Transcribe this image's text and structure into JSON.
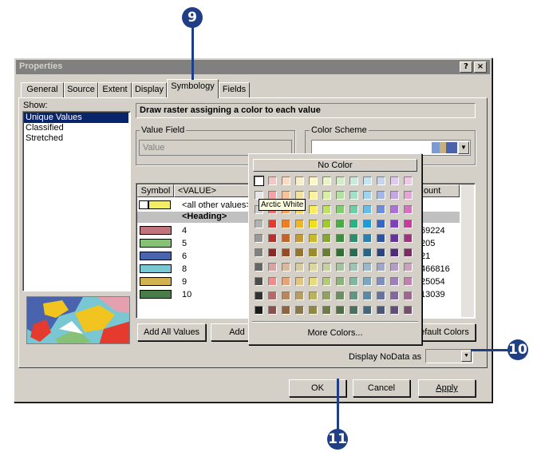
{
  "window": {
    "title": "Properties",
    "help_btn": "?",
    "close_btn": "×"
  },
  "tabs": [
    "General",
    "Source",
    "Extent",
    "Display",
    "Symbology",
    "Fields"
  ],
  "show": {
    "label": "Show:",
    "items": [
      "Unique Values",
      "Classified",
      "Stretched"
    ]
  },
  "header": "Draw raster assigning a color to each value",
  "value_field": {
    "label": "Value Field",
    "value": "Value"
  },
  "color_scheme": {
    "label": "Color Scheme"
  },
  "table": {
    "headers": [
      "Symbol",
      "<VALUE>",
      "Count"
    ],
    "rows": [
      {
        "color": "#f2ee6a",
        "label": "<all other values>",
        "count": ""
      },
      {
        "color": "",
        "label": "<Heading>",
        "count": ""
      },
      {
        "color": "#c2747c",
        "label": "4",
        "count": "69224"
      },
      {
        "color": "#86c176",
        "label": "5",
        "count": "205"
      },
      {
        "color": "#4a63ad",
        "label": "6",
        "count": "21"
      },
      {
        "color": "#78c7d2",
        "label": "8",
        "count": "466816"
      },
      {
        "color": "#d1b24e",
        "label": "9",
        "count": "25054"
      },
      {
        "color": "#4a7c4a",
        "label": "10",
        "count": "13039"
      }
    ]
  },
  "buttons": {
    "add_all": "Add All Values",
    "add_values": "Add Values...",
    "default_colors": "Default Colors",
    "ok": "OK",
    "cancel": "Cancel",
    "apply": "Apply"
  },
  "nodata": {
    "label": "Display NoData as"
  },
  "palette": {
    "no_color": "No Color",
    "more_colors": "More Colors...",
    "tooltip": "Arctic White",
    "rows": [
      [
        "#ffffff",
        "#f4c6c6",
        "#f6dcc4",
        "#f8efc6",
        "#fbf7c8",
        "#e9f4c4",
        "#d2ecca",
        "#c8ecdc",
        "#c6e4f0",
        "#c7d4ef",
        "#dccbed",
        "#f0c8e6"
      ],
      [
        "#e6e6e6",
        "#f3a3a3",
        "#f6c39a",
        "#f7e29c",
        "#fbf29e",
        "#d8ef9e",
        "#b3e0a5",
        "#a2e0c7",
        "#a1d3ec",
        "#a3b7e8",
        "#c4a6e4",
        "#e5a3d8"
      ],
      [
        "#cccccc",
        "#f26b6b",
        "#f5a15f",
        "#f6d35e",
        "#f8ec5f",
        "#c0e35e",
        "#84cc72",
        "#6ad0a6",
        "#67bde6",
        "#6b8edd",
        "#a774d6",
        "#d970c3"
      ],
      [
        "#b2b2b2",
        "#e53a2e",
        "#ef7d22",
        "#f2b61f",
        "#efdf1d",
        "#9fcc2a",
        "#4bab48",
        "#27b382",
        "#1d9bd8",
        "#3366c9",
        "#7f3fbc",
        "#c93a9d"
      ],
      [
        "#999999",
        "#b8302a",
        "#c4642a",
        "#c79a2b",
        "#c9bb2c",
        "#86a833",
        "#3f8c43",
        "#2a8f6c",
        "#2a7fad",
        "#2c54a2",
        "#643596",
        "#a0327f"
      ],
      [
        "#808080",
        "#8c2a25",
        "#954d27",
        "#977428",
        "#9a8d29",
        "#67802e",
        "#336d37",
        "#276d55",
        "#286486",
        "#284482",
        "#502d77",
        "#7c2a65"
      ],
      [
        "#666666",
        "#d9a3a3",
        "#d8b89e",
        "#d8cb9e",
        "#d9d6a0",
        "#c4d09e",
        "#a6c1a1",
        "#9dc4b5",
        "#9cb8c8",
        "#9fa9c7",
        "#b1a0c3",
        "#cc9fbd"
      ],
      [
        "#4d4d4d",
        "#f28c8c",
        "#e5a57a",
        "#e4c57a",
        "#e5dc7b",
        "#b5c97b",
        "#8cb37e",
        "#7cba9f",
        "#7aa8c2",
        "#7d8fc0",
        "#9e80bb",
        "#c47fb1"
      ],
      [
        "#333333",
        "#b86a6a",
        "#b8865f",
        "#b99f5f",
        "#b9b260",
        "#93a25f",
        "#6e8f63",
        "#629580",
        "#6087a2",
        "#6473a0",
        "#7f6a9b",
        "#a1668f"
      ],
      [
        "#1a1a1a",
        "#8c4f4f",
        "#8c6546",
        "#8c7847",
        "#8d8748",
        "#6f7b46",
        "#536c4a",
        "#4a7060",
        "#48667a",
        "#4b5778",
        "#605075",
        "#794d6c"
      ]
    ]
  },
  "callouts": [
    "9",
    "10",
    "11"
  ]
}
